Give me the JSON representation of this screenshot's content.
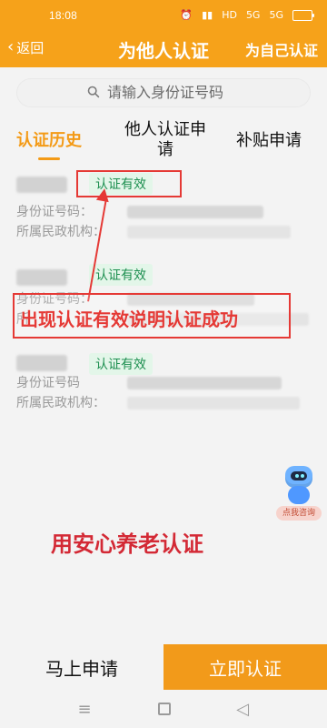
{
  "status": {
    "time": "18:08",
    "signal": "HD",
    "network": "5G",
    "wifi": "5G"
  },
  "nav": {
    "back": "返回",
    "title": "为他人认证",
    "right_action": "为自己认证"
  },
  "search": {
    "placeholder": "请输入身份证号码"
  },
  "tabs": [
    {
      "label": "认证历史",
      "active": true
    },
    {
      "label": "他人认证申\n请",
      "active": false
    },
    {
      "label": "补贴申请",
      "active": false
    }
  ],
  "records": [
    {
      "name": "",
      "badge": "认证有效",
      "id_label": "身份证号码：",
      "id_value": "7***********",
      "org_label": "所属民政机构：",
      "org_value": ""
    },
    {
      "name": "",
      "badge": "认证有效",
      "id_label": "身份证号码：",
      "id_value": "2723******",
      "org_label": "所",
      "org_value": ""
    },
    {
      "name": "",
      "badge": "认证有效",
      "id_label": "身份证号码",
      "id_value": "",
      "org_label": "所属民政机构：",
      "org_value": ""
    }
  ],
  "annotation": {
    "text": "出现认证有效说明认证成功"
  },
  "overlay_watermark": "用安心养老认证",
  "robot": {
    "label": "点我咨询"
  },
  "bottom": {
    "left": "马上申请",
    "right": "立即认证"
  },
  "sysnav": {
    "menu": "≡",
    "home": "□",
    "back": "◁"
  }
}
